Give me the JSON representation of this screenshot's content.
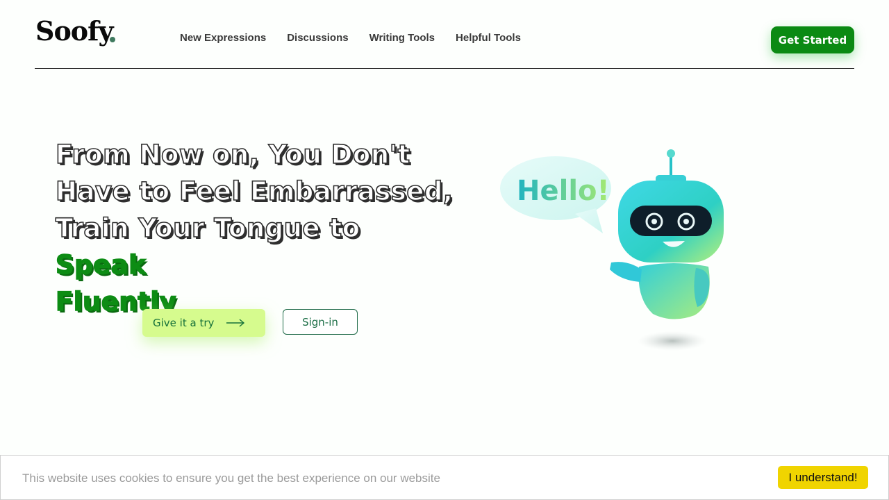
{
  "brand": {
    "logo": "Soofy"
  },
  "nav": {
    "items": [
      {
        "label": "New Expressions"
      },
      {
        "label": "Discussions"
      },
      {
        "label": "Writing Tools"
      },
      {
        "label": "Helpful Tools"
      }
    ],
    "cta_label": "Get Started"
  },
  "hero": {
    "line1": "From Now on, You Don't",
    "line2": "Have to Feel Embarrassed,",
    "line3_prefix": "Train Your Tongue to ",
    "highlight1": "Speak",
    "highlight2": "Fluently",
    "try_label": "Give it a try",
    "signin_label": "Sign-in",
    "bubble_text": "Hello!"
  },
  "cookie": {
    "message": "This website uses cookies to ensure you get the best experience on our website",
    "button_label": "I understand!"
  },
  "colors": {
    "brand_green": "#0b8a13",
    "try_button": "#d6fb8e",
    "cookie_button": "#f0d400",
    "robot_teal": "#26d1c9"
  },
  "icons": {
    "try_arrow": "arrow-right-icon"
  }
}
